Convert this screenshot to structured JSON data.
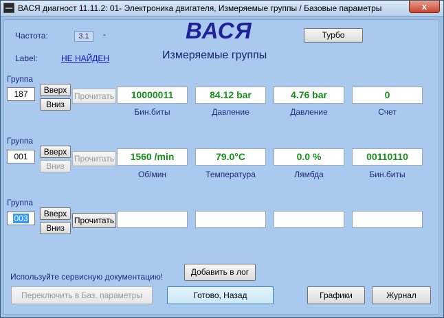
{
  "window": {
    "title": "ВАСЯ диагност 11.11.2: 01- Электроника двигателя,  Измеряемые группы / Базовые параметры",
    "close_label": "x"
  },
  "header": {
    "freq_label": "Частота:",
    "freq_value": "3.1",
    "freq_dash": "-",
    "label_label": "Label:",
    "label_value": "НЕ НАЙДЕН",
    "logo": "ВАСЯ",
    "subtitle": "Измеряемые группы",
    "turbo_label": "Турбо"
  },
  "groups": [
    {
      "group_label": "Группа",
      "number": "187",
      "up_label": "Вверх",
      "down_label": "Вниз",
      "read_label": "Прочитать",
      "fields": [
        {
          "value": "10000011",
          "caption": "Бин.биты"
        },
        {
          "value": "84.12 bar",
          "caption": "Давление"
        },
        {
          "value": "4.76 bar",
          "caption": "Давление"
        },
        {
          "value": "0",
          "caption": "Счет"
        }
      ]
    },
    {
      "group_label": "Группа",
      "number": "001",
      "up_label": "Вверх",
      "down_label": "Вниз",
      "read_label": "Прочитать",
      "fields": [
        {
          "value": "1560 /min",
          "caption": "Об/мин"
        },
        {
          "value": "79.0°C",
          "caption": "Температура"
        },
        {
          "value": "0.0 %",
          "caption": "Лямбда"
        },
        {
          "value": "00110110",
          "caption": "Бин.биты"
        }
      ]
    },
    {
      "group_label": "Группа",
      "number": "003",
      "up_label": "Вверх",
      "down_label": "Вниз",
      "read_label": "Прочитать",
      "fields": [
        {
          "value": "",
          "caption": ""
        },
        {
          "value": "",
          "caption": ""
        },
        {
          "value": "",
          "caption": ""
        },
        {
          "value": "",
          "caption": ""
        }
      ]
    }
  ],
  "footer": {
    "hint": "Используйте сервисную документацию!",
    "add_log_label": "Добавить в лог",
    "switch_label": "Переключить в Баз. параметры",
    "done_label": "Готово, Назад",
    "graphs_label": "Графики",
    "journal_label": "Журнал"
  }
}
